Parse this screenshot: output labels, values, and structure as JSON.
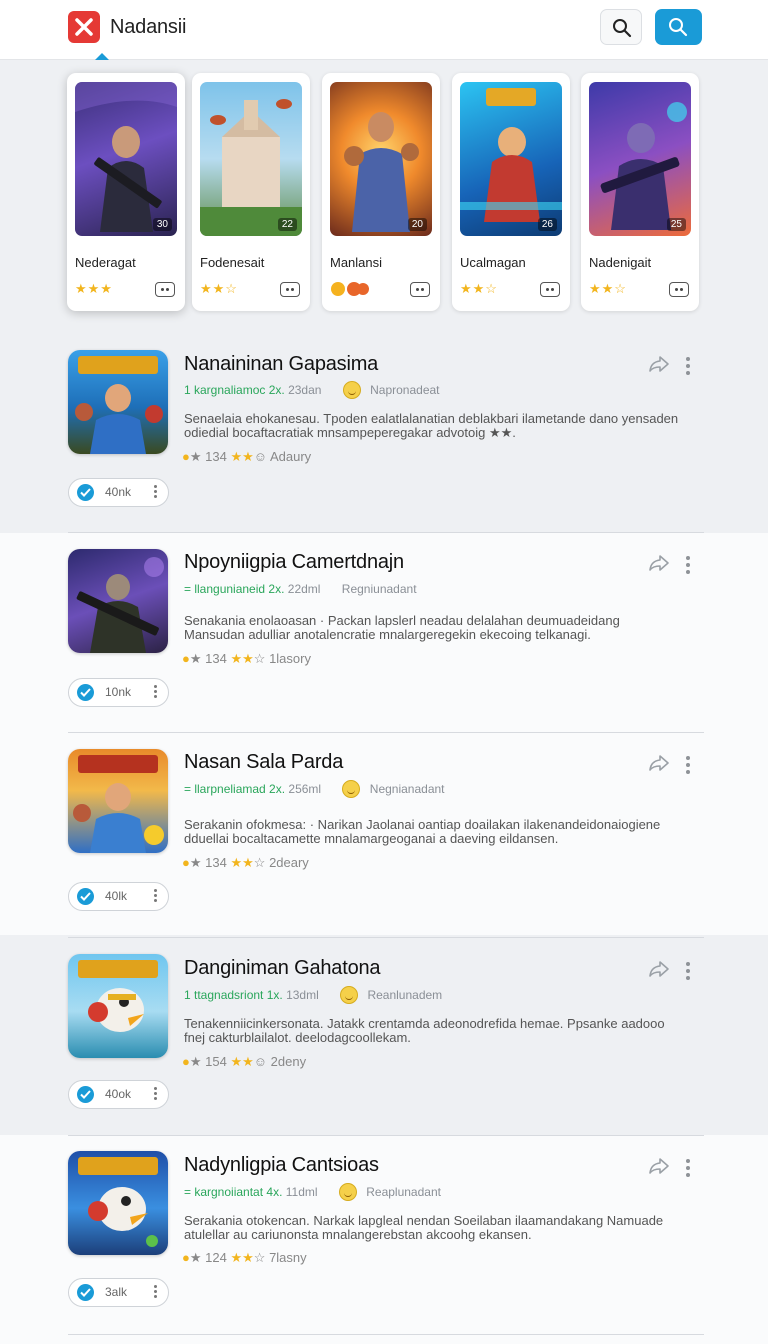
{
  "header": {
    "app_name": "Nadansii"
  },
  "featured": [
    {
      "title": "Nederagat",
      "badge": "30",
      "rating": "★★★"
    },
    {
      "title": "Fodenesait",
      "badge": "22",
      "rating": "★★☆"
    },
    {
      "title": "Manlansi",
      "badge": "20",
      "rating": ""
    },
    {
      "title": "Ucalmagan",
      "badge": "26",
      "rating": "★★☆"
    },
    {
      "title": "Nadenigait",
      "badge": "25",
      "rating": "★★☆"
    }
  ],
  "entries": [
    {
      "title": "Nanaininan Gapasima",
      "meta_left": "1 kargnaliamoc 2x.",
      "meta_size": "23dan",
      "meta_right": "Napronadeat",
      "desc": "Senaelaia ehokanesau. Tpoden ealatlalanatian deblakbari ilametande dano yensaden odiedial bocaftacratiak mnsampeperegakar advotoig ★★.",
      "stats_count": "134",
      "stats_extra": "Adaury",
      "pill_count": "40nk"
    },
    {
      "title": "Npoyniigpia Camertdnajn",
      "meta_left": "= llangunianeid 2x.",
      "meta_size": "22dml",
      "meta_right": "Regniunadant",
      "desc": "Senakania enolaoasan · Packan lapslerl neadau delalahan deumuadeidang Mansudan adulliar anotalencratie mnalargeregekin ekecoing telkanagi.",
      "stats_count": "134",
      "stats_extra": "1lasory",
      "pill_count": "10nk"
    },
    {
      "title": "Nasan Sala Parda",
      "meta_left": "= llarpneliamad 2x.",
      "meta_size": "256ml",
      "meta_right": "Negnianadant",
      "desc": "Serakanin ofokmesa: · Narikan Jaolanai oantiap doailakan ilakenandeidonaiogiene dduellai bocaltacamette mnalamargeoganai a daeving eildansen.",
      "stats_count": "134",
      "stats_extra": "2deary",
      "pill_count": "40lk"
    },
    {
      "title": "Danginiman Gahatona",
      "meta_left": "1 ttagnadsriont 1x.",
      "meta_size": "13dml",
      "meta_right": "Reanlunadem",
      "desc": "Tenakenniicinkersonata. Jatakk crentamda adeonodrefida hemae. Ppsanke aadooo fnej cakturblailalot. deelodagcoollekam.",
      "stats_count": "154",
      "stats_extra": "2deny",
      "pill_count": "40ok"
    },
    {
      "title": "Nadynligpia Cantsioas",
      "meta_left": "= kargnoiiantat 4x.",
      "meta_size": "11dml",
      "meta_right": "Reaplunadant",
      "desc": "Serakania otokencan. Narkak lapgleal nendan Soeilaban ilaamandakang Namuade atulellar au cariunonsta mnalangerebstan akcoohg ekansen.",
      "stats_count": "124",
      "stats_extra": "7lasny",
      "pill_count": "3alk"
    }
  ],
  "colors": {
    "accent": "#1a9bd7",
    "logo": "#e53935",
    "star": "#f2b51e",
    "green_meta": "#2aa65b"
  },
  "icons": [
    "x-logo-icon",
    "search-icon",
    "share-icon",
    "more-vert-icon",
    "check-icon",
    "emoji-icon"
  ]
}
